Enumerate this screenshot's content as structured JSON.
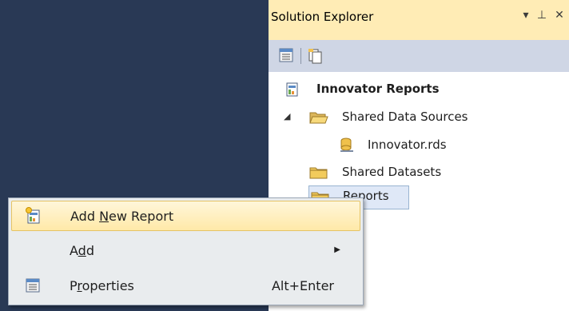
{
  "solution_explorer": {
    "title": "Solution Explorer",
    "buttons": {
      "dropdown": "▾",
      "pin": "⊥",
      "close": "✕"
    },
    "toolbar": {
      "items": [
        "properties-icon",
        "show-all-files-icon"
      ]
    },
    "tree": {
      "project": "Innovator Reports",
      "shared_data_sources": "Shared Data Sources",
      "datasource_file": "Innovator.rds",
      "shared_datasets": "Shared Datasets",
      "reports": "Reports"
    }
  },
  "context_menu": {
    "add_new_report": {
      "pre": "Add ",
      "accel": "N",
      "post": "ew Report"
    },
    "add": {
      "pre": "A",
      "accel": "d",
      "post": "d",
      "arrow": "▶"
    },
    "properties": {
      "pre": "P",
      "accel": "r",
      "post": "operties",
      "shortcut": "Alt+Enter"
    }
  },
  "colors": {
    "ide_background": "#293955",
    "title_highlight": "#ffecb5",
    "toolbar": "#cfd6e5",
    "menu_hot": "#ffe9a8"
  }
}
